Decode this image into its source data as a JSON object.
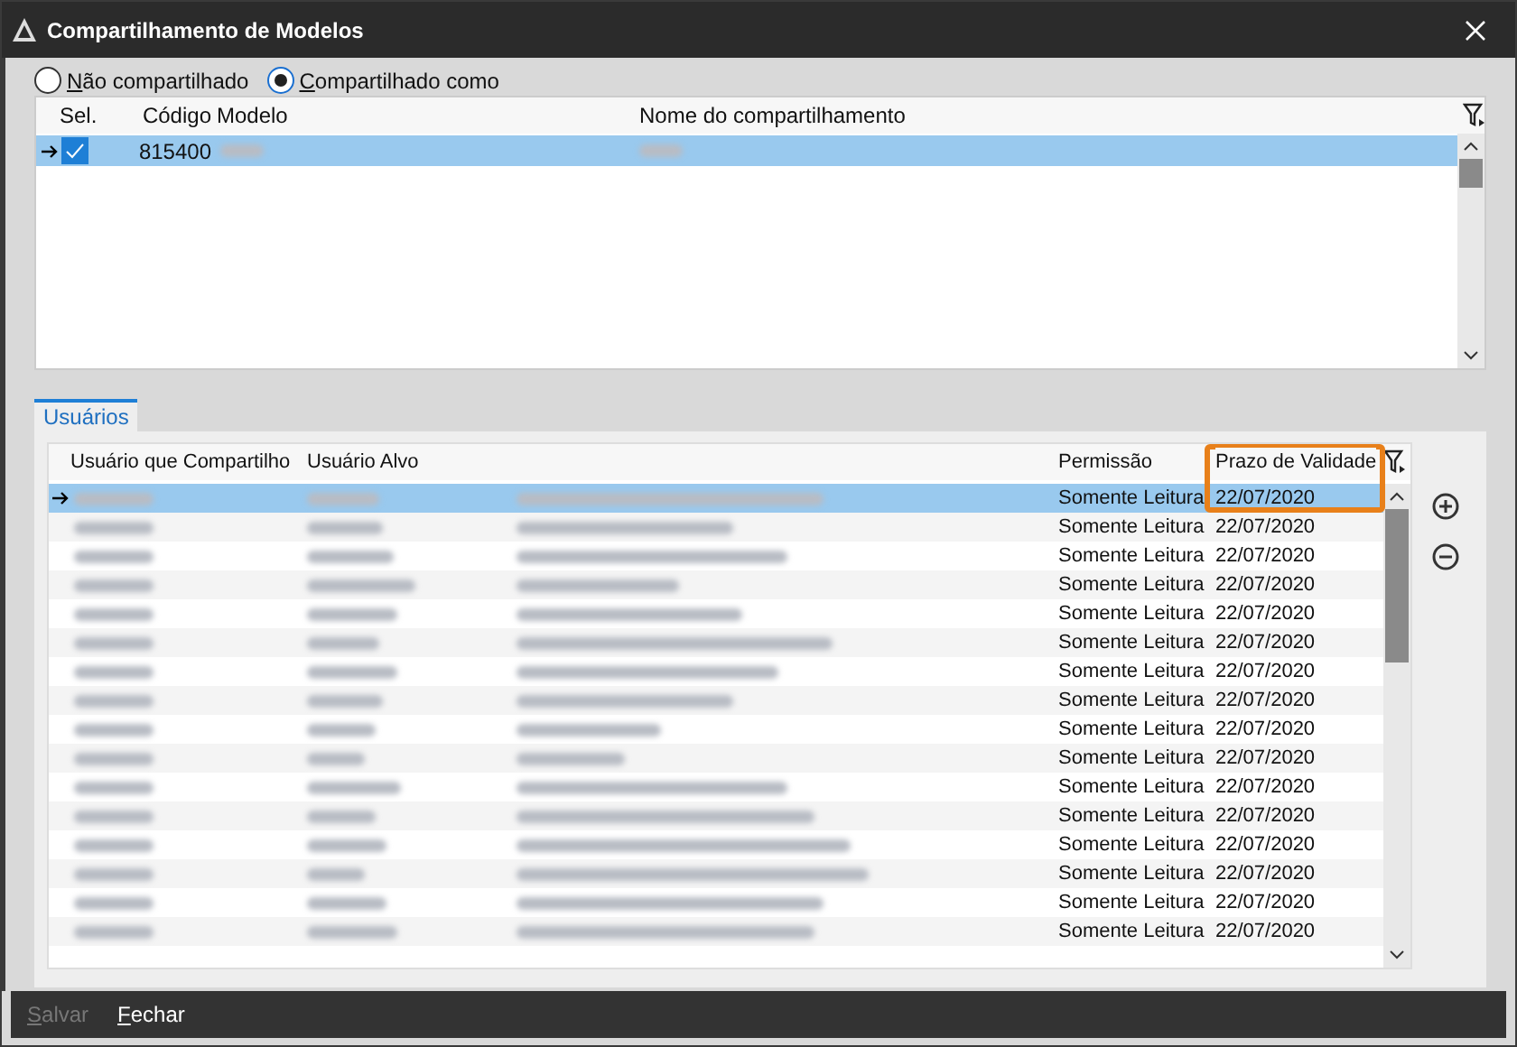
{
  "window": {
    "title": "Compartilhamento de Modelos"
  },
  "share_mode": [
    {
      "label": "Não compartilhado",
      "selected": false
    },
    {
      "label": "Compartilhado como",
      "selected": true
    }
  ],
  "models_table": {
    "columns": [
      "Sel.",
      "Código",
      "Modelo",
      "Nome do compartilhamento"
    ],
    "rows": [
      {
        "selected": true,
        "checked": true,
        "code": "815400"
      }
    ]
  },
  "tabs": [
    {
      "label": "Usuários",
      "selected": true
    }
  ],
  "users_table": {
    "highlight_frame": true,
    "columns": [
      {
        "label": "Usuário que Compartilho"
      },
      {
        "label": "Usuário Alvo"
      },
      {
        "label": "Permissão"
      },
      {
        "label": "Prazo de Validade"
      }
    ],
    "rows": [
      {
        "selected": true,
        "permission": "Somente Leitura",
        "valid_until": "22/07/2020"
      },
      {
        "selected": false,
        "permission": "Somente Leitura",
        "valid_until": "22/07/2020"
      },
      {
        "selected": false,
        "permission": "Somente Leitura",
        "valid_until": "22/07/2020"
      },
      {
        "selected": false,
        "permission": "Somente Leitura",
        "valid_until": "22/07/2020"
      },
      {
        "selected": false,
        "permission": "Somente Leitura",
        "valid_until": "22/07/2020"
      },
      {
        "selected": false,
        "permission": "Somente Leitura",
        "valid_until": "22/07/2020"
      },
      {
        "selected": false,
        "permission": "Somente Leitura",
        "valid_until": "22/07/2020"
      },
      {
        "selected": false,
        "permission": "Somente Leitura",
        "valid_until": "22/07/2020"
      },
      {
        "selected": false,
        "permission": "Somente Leitura",
        "valid_until": "22/07/2020"
      },
      {
        "selected": false,
        "permission": "Somente Leitura",
        "valid_until": "22/07/2020"
      },
      {
        "selected": false,
        "permission": "Somente Leitura",
        "valid_until": "22/07/2020"
      },
      {
        "selected": false,
        "permission": "Somente Leitura",
        "valid_until": "22/07/2020"
      },
      {
        "selected": false,
        "permission": "Somente Leitura",
        "valid_until": "22/07/2020"
      },
      {
        "selected": false,
        "permission": "Somente Leitura",
        "valid_until": "22/07/2020"
      },
      {
        "selected": false,
        "permission": "Somente Leitura",
        "valid_until": "22/07/2020"
      },
      {
        "selected": false,
        "permission": "Somente Leitura",
        "valid_until": "22/07/2020"
      }
    ]
  },
  "buttons": [
    {
      "label": "Salvar",
      "disabled": true
    },
    {
      "label": "Fechar",
      "disabled": false
    }
  ]
}
